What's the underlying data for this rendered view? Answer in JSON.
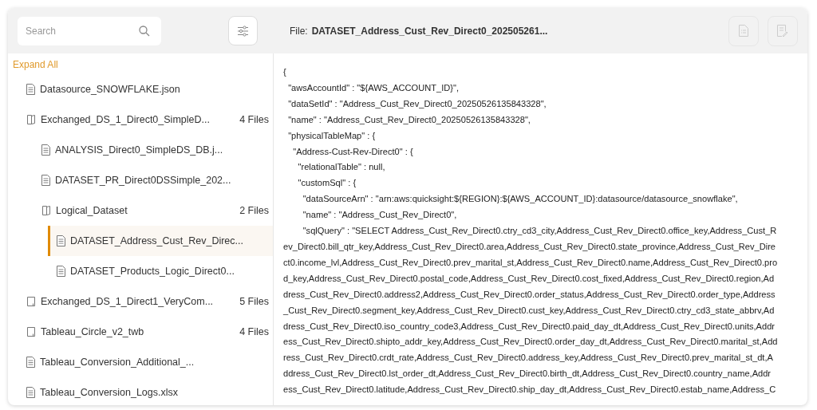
{
  "search": {
    "placeholder": "Search"
  },
  "file_header": {
    "label": "File:",
    "name": "DATASET_Address_Cust_Rev_Direct0_202505261..."
  },
  "header_actions": [
    {
      "kind": "doc-list",
      "disabled": true
    },
    {
      "kind": "doc-edit",
      "disabled": true
    }
  ],
  "expand_all": "Expand All",
  "tree": [
    {
      "kind": "file",
      "name": "Datasource_SNOWFLAKE.json",
      "selected": false
    },
    {
      "kind": "folder",
      "name": "Exchanged_DS_1_Direct0_SimpleD...",
      "count": "4 Files",
      "expanded": true,
      "selected": false,
      "children": [
        {
          "kind": "file",
          "name": "ANALYSIS_Direct0_SimpleDS_DB.j...",
          "selected": false
        },
        {
          "kind": "file",
          "name": "DATASET_PR_Direct0DSSimple_202...",
          "selected": false
        },
        {
          "kind": "folder",
          "name": "Logical_Dataset",
          "count": "2 Files",
          "expanded": true,
          "selected": false,
          "children": [
            {
              "kind": "file",
              "name": "DATASET_Address_Cust_Rev_Direc...",
              "selected": true
            },
            {
              "kind": "file",
              "name": "DATASET_Products_Logic_Direct0...",
              "selected": false
            }
          ]
        }
      ]
    },
    {
      "kind": "folder",
      "name": "Exchanged_DS_1_Direct1_VeryCom...",
      "count": "5 Files",
      "expanded": false,
      "selected": false
    },
    {
      "kind": "folder",
      "name": "Tableau_Circle_v2_twb",
      "count": "4 Files",
      "expanded": false,
      "selected": false
    },
    {
      "kind": "file",
      "name": "Tableau_Conversion_Additional_...",
      "selected": false
    },
    {
      "kind": "file",
      "name": "Tableau_Conversion_Logs.xlsx",
      "selected": false
    }
  ],
  "code_lines": [
    "{",
    "  \"awsAccountId\" : \"${AWS_ACCOUNT_ID}\",",
    "  \"dataSetId\" : \"Address_Cust_Rev_Direct0_20250526135843328\",",
    "  \"name\" : \"Address_Cust_Rev_Direct0_20250526135843328\",",
    "  \"physicalTableMap\" : {",
    "    \"Address-Cust-Rev-Direct0\" : {",
    "      \"relationalTable\" : null,",
    "      \"customSql\" : {",
    "        \"dataSourceArn\" : \"arn:aws:quicksight:${REGION}:${AWS_ACCOUNT_ID}:datasource/datasource_snowflake\",",
    "        \"name\" : \"Address_Cust_Rev_Direct0\",",
    "        \"sqlQuery\" : \"SELECT Address_Cust_Rev_Direct0.ctry_cd3_city,Address_Cust_Rev_Direct0.office_key,Address_Cust_R",
    "ev_Direct0.bill_qtr_key,Address_Cust_Rev_Direct0.area,Address_Cust_Rev_Direct0.state_province,Address_Cust_Rev_Dire",
    "ct0.income_lvl,Address_Cust_Rev_Direct0.prev_marital_st,Address_Cust_Rev_Direct0.name,Address_Cust_Rev_Direct0.pro",
    "d_key,Address_Cust_Rev_Direct0.postal_code,Address_Cust_Rev_Direct0.cost_fixed,Address_Cust_Rev_Direct0.region,Ad",
    "dress_Cust_Rev_Direct0.address2,Address_Cust_Rev_Direct0.order_status,Address_Cust_Rev_Direct0.order_type,Address",
    "_Cust_Rev_Direct0.segment_key,Address_Cust_Rev_Direct0.cust_key,Address_Cust_Rev_Direct0.ctry_cd3_state_abbrv,Ad",
    "dress_Cust_Rev_Direct0.iso_country_code3,Address_Cust_Rev_Direct0.paid_day_dt,Address_Cust_Rev_Direct0.units,Addr",
    "ess_Cust_Rev_Direct0.shipto_addr_key,Address_Cust_Rev_Direct0.order_day_dt,Address_Cust_Rev_Direct0.marital_st,Add",
    "ress_Cust_Rev_Direct0.crdt_rate,Address_Cust_Rev_Direct0.address_key,Address_Cust_Rev_Direct0.prev_marital_st_dt,A",
    "ddress_Cust_Rev_Direct0.lst_order_dt,Address_Cust_Rev_Direct0.birth_dt,Address_Cust_Rev_Direct0.country_name,Addr",
    "ess_Cust_Rev_Direct0.latitude,Address_Cust_Rev_Direct0.ship_day_dt,Address_Cust_Rev_Direct0.estab_name,Address_C"
  ]
}
